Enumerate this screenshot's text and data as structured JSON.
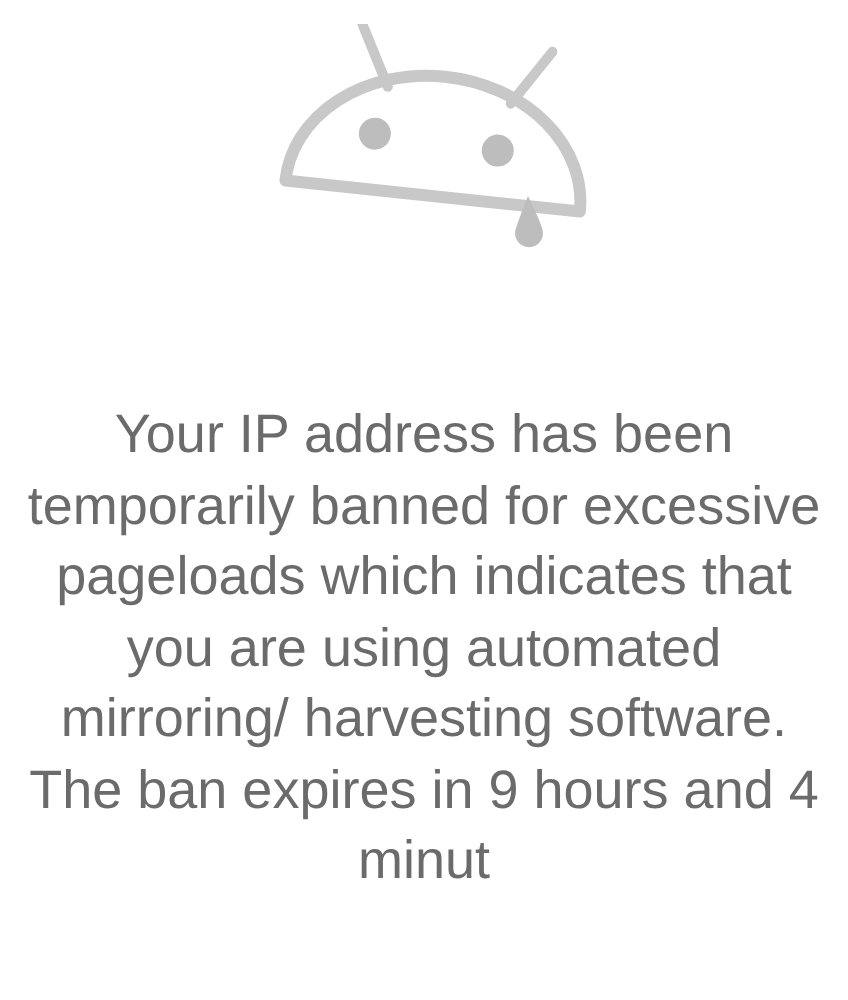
{
  "message": "Your IP address has been temporarily banned for excessive pageloads which indicates that you are using automated mirroring/ harvesting software. The ban expires in 9 hours and 4 minut"
}
